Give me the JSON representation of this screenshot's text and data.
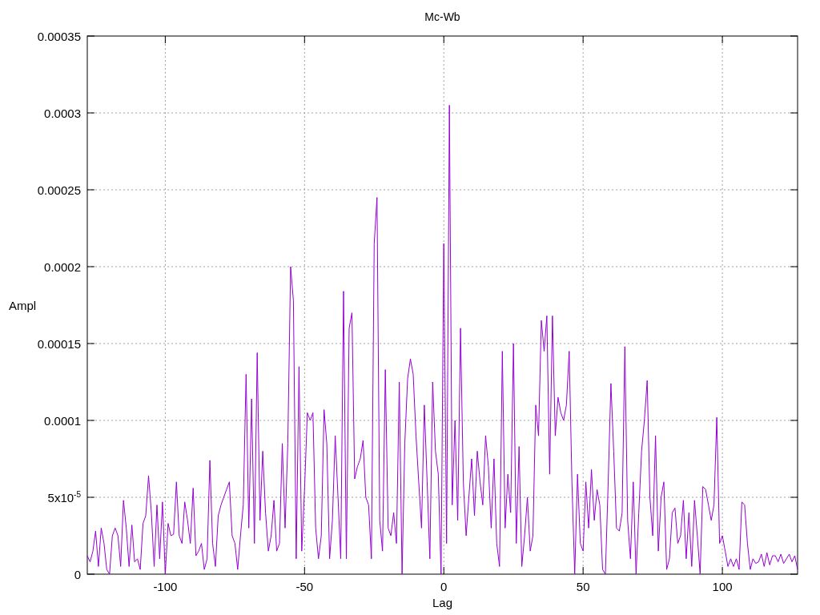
{
  "chart_data": {
    "type": "line",
    "grid": true,
    "title": "Mc-Wb",
    "xlabel": "Lag",
    "ylabel": "Ampl",
    "xlim": [
      -128,
      127
    ],
    "ylim": [
      0,
      0.00035
    ],
    "xticks": [
      -100,
      -50,
      0,
      50,
      100
    ],
    "yticks": [
      {
        "value": 0,
        "label": "0"
      },
      {
        "value": 5e-05,
        "label": "5x10$^{-5}$"
      },
      {
        "value": 0.0001,
        "label": "0.0001"
      },
      {
        "value": 0.00015,
        "label": "0.00015"
      },
      {
        "value": 0.0002,
        "label": "0.0002"
      },
      {
        "value": 0.00025,
        "label": "0.00025"
      },
      {
        "value": 0.0003,
        "label": "0.0003"
      },
      {
        "value": 0.00035,
        "label": "0.00035"
      }
    ],
    "x": [
      -128,
      -127,
      -126,
      -125,
      -124,
      -123,
      -122,
      -121,
      -120,
      -119,
      -118,
      -117,
      -116,
      -115,
      -114,
      -113,
      -112,
      -111,
      -110,
      -109,
      -108,
      -107,
      -106,
      -105,
      -104,
      -103,
      -102,
      -101,
      -100,
      -99,
      -98,
      -97,
      -96,
      -95,
      -94,
      -93,
      -92,
      -91,
      -90,
      -89,
      -88,
      -87,
      -86,
      -85,
      -84,
      -83,
      -82,
      -81,
      -80,
      -79,
      -78,
      -77,
      -76,
      -75,
      -74,
      -73,
      -72,
      -71,
      -70,
      -69,
      -68,
      -67,
      -66,
      -65,
      -64,
      -63,
      -62,
      -61,
      -60,
      -59,
      -58,
      -57,
      -56,
      -55,
      -54,
      -53,
      -52,
      -51,
      -50,
      -49,
      -48,
      -47,
      -46,
      -45,
      -44,
      -43,
      -42,
      -41,
      -40,
      -39,
      -38,
      -37,
      -36,
      -35,
      -34,
      -33,
      -32,
      -31,
      -30,
      -29,
      -28,
      -27,
      -26,
      -25,
      -24,
      -23,
      -22,
      -21,
      -20,
      -19,
      -18,
      -17,
      -16,
      -15,
      -14,
      -13,
      -12,
      -11,
      -10,
      -9,
      -8,
      -7,
      -6,
      -5,
      -4,
      -3,
      -2,
      -1,
      0,
      1,
      2,
      3,
      4,
      5,
      6,
      7,
      8,
      9,
      10,
      11,
      12,
      13,
      14,
      15,
      16,
      17,
      18,
      19,
      20,
      21,
      22,
      23,
      24,
      25,
      26,
      27,
      28,
      29,
      30,
      31,
      32,
      33,
      34,
      35,
      36,
      37,
      38,
      39,
      40,
      41,
      42,
      43,
      44,
      45,
      46,
      47,
      48,
      49,
      50,
      51,
      52,
      53,
      54,
      55,
      56,
      57,
      58,
      59,
      60,
      61,
      62,
      63,
      64,
      65,
      66,
      67,
      68,
      69,
      70,
      71,
      72,
      73,
      74,
      75,
      76,
      77,
      78,
      79,
      80,
      81,
      82,
      83,
      84,
      85,
      86,
      87,
      88,
      89,
      90,
      91,
      92,
      93,
      94,
      95,
      96,
      97,
      98,
      99,
      100,
      101,
      102,
      103,
      104,
      105,
      106,
      107,
      108,
      109,
      110,
      111,
      112,
      113,
      114,
      115,
      116,
      117,
      118,
      119,
      120,
      121,
      122,
      123,
      124,
      125,
      126,
      127
    ],
    "series": [
      {
        "color": "#9400d3",
        "values": [
          1.2e-05,
          8e-06,
          1.5e-05,
          2.8e-05,
          5e-06,
          3e-05,
          2e-05,
          3e-06,
          0,
          2.5e-05,
          3e-05,
          2.5e-05,
          5e-06,
          4.8e-05,
          3e-05,
          5e-06,
          3.2e-05,
          8e-06,
          1e-05,
          3e-06,
          3.3e-05,
          3.8e-05,
          6.4e-05,
          4e-05,
          5e-06,
          4.5e-05,
          1e-05,
          4.7e-05,
          0,
          3.3e-05,
          2.5e-05,
          2.6e-05,
          6e-05,
          2.5e-05,
          2e-05,
          4.7e-05,
          3.5e-05,
          2e-05,
          5.6e-05,
          1.2e-05,
          1.5e-05,
          2e-05,
          3e-06,
          1e-05,
          7.4e-05,
          2e-05,
          5e-06,
          3.8e-05,
          4.5e-05,
          5e-05,
          5.5e-05,
          6e-05,
          2.5e-05,
          2e-05,
          3e-06,
          2.5e-05,
          4.5e-05,
          0.00013,
          3e-05,
          0.000114,
          2e-05,
          0.000144,
          3.5e-05,
          8e-05,
          4e-05,
          1.5e-05,
          2.5e-05,
          4.8e-05,
          1.5e-05,
          2e-05,
          8.5e-05,
          3e-05,
          8.5e-05,
          0.0002,
          0.000178,
          1e-05,
          0.000135,
          1.5e-05,
          5.5e-05,
          0.000105,
          0.0001,
          0.000105,
          3e-05,
          1e-05,
          2.5e-05,
          0.000107,
          8.5e-05,
          1e-05,
          3.5e-05,
          9e-05,
          5e-05,
          1e-05,
          0.000184,
          1e-05,
          0.00016,
          0.00017,
          6.2e-05,
          7e-05,
          7.5e-05,
          8.7e-05,
          5e-05,
          4.5e-05,
          1e-05,
          0.000215,
          0.000245,
          3.5e-05,
          1.5e-05,
          0.000133,
          3e-05,
          2.5e-05,
          4e-05,
          2e-05,
          0.000125,
          0,
          8.5e-05,
          0.000127,
          0.00014,
          0.00013,
          9e-05,
          6e-05,
          3e-05,
          0.00011,
          6e-05,
          1e-05,
          0.000125,
          8e-05,
          6.5e-05,
          0,
          0.000215,
          2e-05,
          0.000305,
          4.5e-05,
          0.0001,
          3.5e-05,
          0.00016,
          6e-05,
          2.5e-05,
          5e-05,
          7.5e-05,
          3.8e-05,
          8e-05,
          6e-05,
          4.5e-05,
          9e-05,
          7e-05,
          3e-05,
          7.5e-05,
          2e-05,
          5e-06,
          0.000145,
          3e-05,
          6.5e-05,
          4e-05,
          0.00015,
          2e-05,
          8.3e-05,
          5e-06,
          2.5e-05,
          5e-05,
          1.5e-05,
          2.5e-05,
          0.00011,
          9e-05,
          0.000165,
          0.000145,
          0.000168,
          6.5e-05,
          0.000168,
          9e-05,
          0.000115,
          0.000105,
          0.0001,
          0.00011,
          0.000145,
          6e-05,
          0,
          6.5e-05,
          2e-05,
          1.5e-05,
          6e-05,
          3e-05,
          6.8e-05,
          3.5e-05,
          5.5e-05,
          4.5e-05,
          3e-06,
          0,
          6e-05,
          0.000124,
          8e-05,
          3e-05,
          2.8e-05,
          4e-05,
          0.000148,
          3.5e-05,
          1e-05,
          6e-05,
          0,
          4e-05,
          8e-05,
          0.0001,
          0.000126,
          5e-05,
          2.5e-05,
          9e-05,
          1.5e-05,
          5e-05,
          6e-05,
          3e-06,
          1e-05,
          4e-05,
          4.3e-05,
          2e-05,
          2.5e-05,
          4.8e-05,
          1e-05,
          4e-05,
          5e-06,
          4.8e-05,
          2.5e-05,
          0,
          5.7e-05,
          5.5e-05,
          4.5e-05,
          3.5e-05,
          4.5e-05,
          0.000102,
          2e-05,
          2.5e-05,
          1.5e-05,
          5e-06,
          1e-05,
          5e-06,
          1e-05,
          3e-06,
          4.7e-05,
          4.5e-05,
          2e-05,
          3e-06,
          1e-05,
          7e-06,
          8e-06,
          1.3e-05,
          5e-06,
          1.4e-05,
          6e-06,
          1.2e-05,
          1.2e-05,
          8e-06,
          1.3e-05,
          7e-06,
          1e-05,
          1.3e-05,
          8e-06,
          1.2e-05,
          3e-06
        ]
      }
    ]
  }
}
